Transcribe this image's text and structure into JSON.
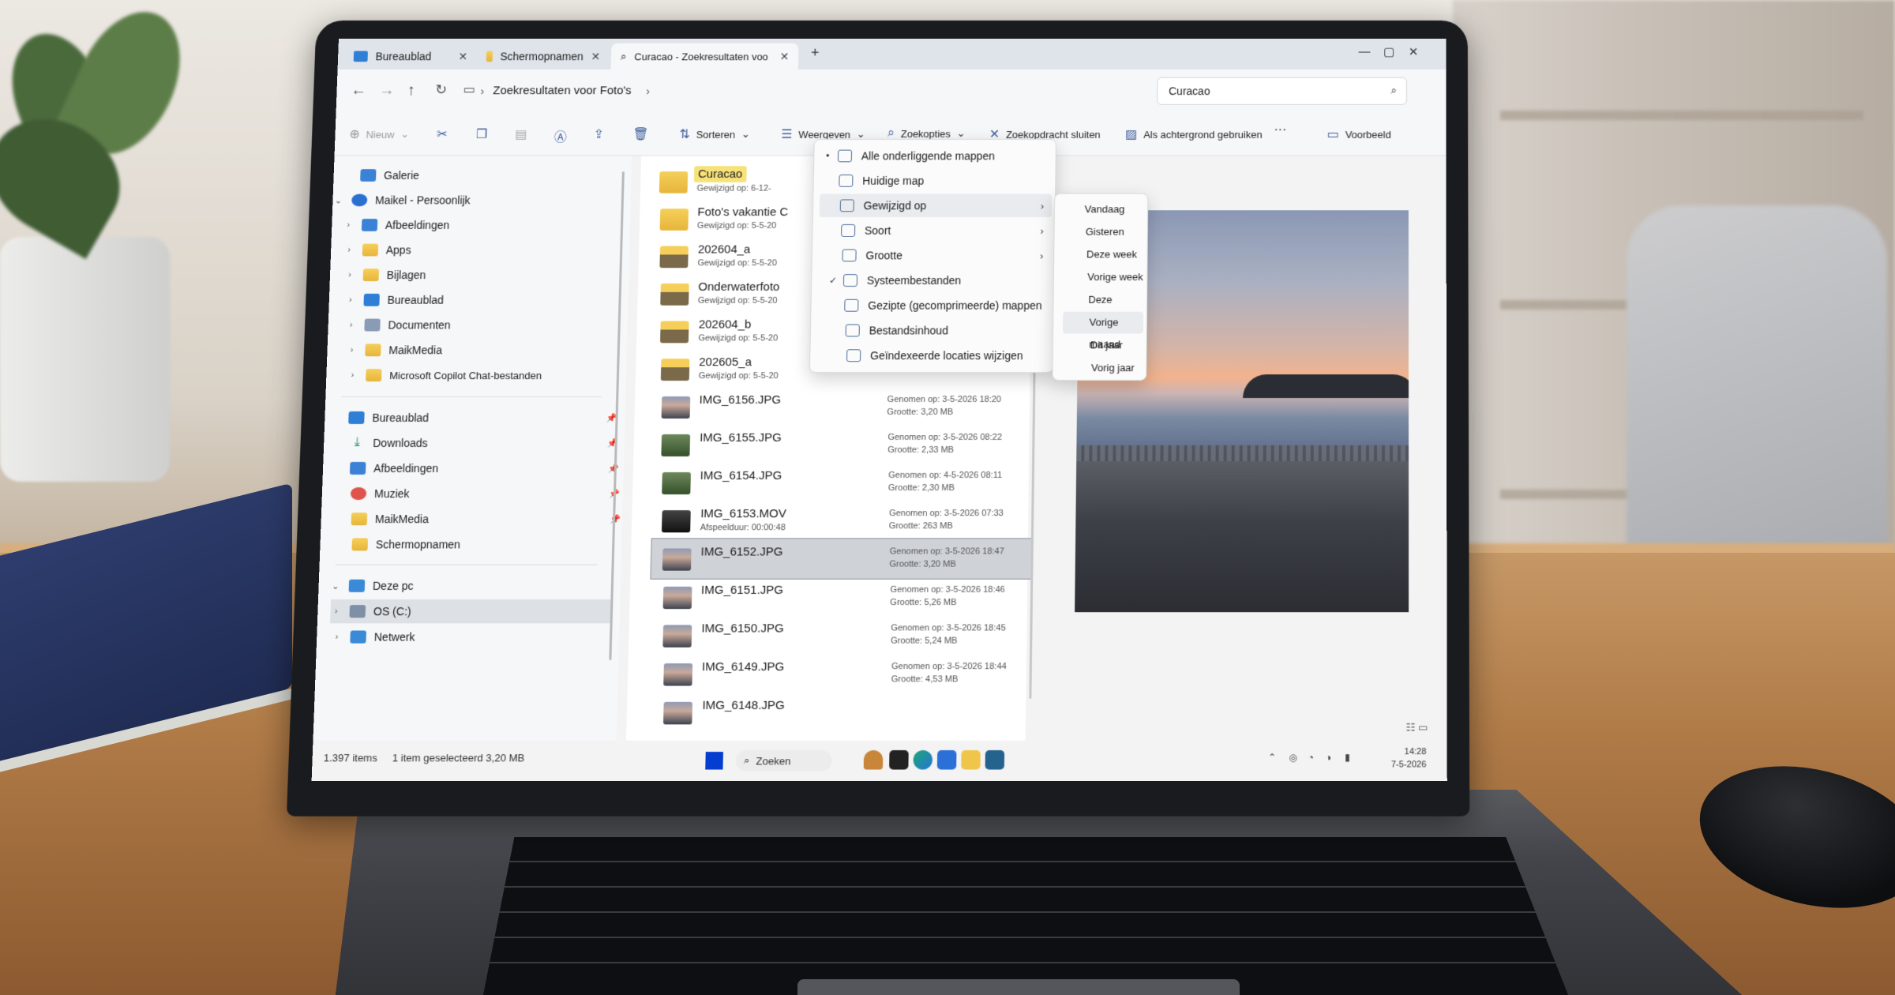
{
  "window": {
    "tabs": [
      {
        "label": "Bureaublad"
      },
      {
        "label": "Schermopnamen"
      },
      {
        "label": "Curacao - Zoekresultaten voo"
      }
    ],
    "new_tab": "+"
  },
  "address": {
    "breadcrumb": "Zoekresultaten voor Foto's",
    "search_value": "Curacao"
  },
  "commands": {
    "new": "Nieuw",
    "sort": "Sorteren",
    "view": "Weergeven",
    "search_options": "Zoekopties",
    "close_search": "Zoekopdracht sluiten",
    "set_background": "Als achtergrond gebruiken",
    "more": "···",
    "preview": "Voorbeeld"
  },
  "nav": {
    "gallery": "Galerie",
    "personal": "Maikel - Persoonlijk",
    "personal_children": [
      "Afbeeldingen",
      "Apps",
      "Bijlagen",
      "Bureaublad",
      "Documenten",
      "MaikMedia",
      "Microsoft Copilot Chat-bestanden"
    ],
    "quick_access": [
      "Bureaublad",
      "Downloads",
      "Afbeeldingen",
      "Muziek",
      "MaikMedia",
      "Schermopnamen"
    ],
    "this_pc": "Deze pc",
    "drive": "OS (C:)",
    "network": "Netwerk"
  },
  "files": [
    {
      "name": "Curacao",
      "sub": "Gewijzigd op: 6-12-",
      "meta1": "",
      "meta2": "",
      "kind": "folder"
    },
    {
      "name": "Foto's vakantie C",
      "sub": "Gewijzigd op: 5-5-20",
      "meta1": "",
      "meta2": "",
      "kind": "folder"
    },
    {
      "name": "202604_a",
      "sub": "Gewijzigd op: 5-5-20",
      "meta1": "",
      "meta2": "",
      "kind": "folder-img"
    },
    {
      "name": "Onderwaterfoto",
      "sub": "Gewijzigd op: 5-5-20",
      "meta1": "",
      "meta2": "",
      "kind": "folder-img"
    },
    {
      "name": "202604_b",
      "sub": "Gewijzigd op: 5-5-20",
      "meta1": "",
      "meta2": "",
      "kind": "folder-img"
    },
    {
      "name": "202605_a",
      "sub": "Gewijzigd op: 5-5-20",
      "meta1": "",
      "meta2": "",
      "kind": "folder-img"
    },
    {
      "name": "IMG_6156.JPG",
      "sub": "",
      "meta1": "Genomen op: 3-5-2026 18:20",
      "meta2": "Grootte: 3,20 MB",
      "kind": "image"
    },
    {
      "name": "IMG_6155.JPG",
      "sub": "",
      "meta1": "Genomen op: 3-5-2026 08:22",
      "meta2": "Grootte: 2,33 MB",
      "kind": "image-green"
    },
    {
      "name": "IMG_6154.JPG",
      "sub": "",
      "meta1": "Genomen op: 4-5-2026 08:11",
      "meta2": "Grootte: 2,30 MB",
      "kind": "image-green"
    },
    {
      "name": "IMG_6153.MOV",
      "sub": "Afspeelduur: 00:00:48",
      "meta1": "Genomen op: 3-5-2026 07:33",
      "meta2": "Grootte: 263 MB",
      "kind": "video"
    },
    {
      "name": "IMG_6152.JPG",
      "sub": "",
      "meta1": "Genomen op: 3-5-2026 18:47",
      "meta2": "Grootte: 3,20 MB",
      "kind": "image"
    },
    {
      "name": "IMG_6151.JPG",
      "sub": "",
      "meta1": "Genomen op: 3-5-2026 18:46",
      "meta2": "Grootte: 5,26 MB",
      "kind": "image"
    },
    {
      "name": "IMG_6150.JPG",
      "sub": "",
      "meta1": "Genomen op: 3-5-2026 18:45",
      "meta2": "Grootte: 5,24 MB",
      "kind": "image"
    },
    {
      "name": "IMG_6149.JPG",
      "sub": "",
      "meta1": "Genomen op: 3-5-2026 18:44",
      "meta2": "Grootte: 4,53 MB",
      "kind": "image"
    },
    {
      "name": "IMG_6148.JPG",
      "sub": "",
      "meta1": "",
      "meta2": "",
      "kind": "image"
    }
  ],
  "menu": {
    "items": [
      "Alle onderliggende mappen",
      "Huidige map",
      "Gewijzigd op",
      "Soort",
      "Grootte",
      "Systeembestanden",
      "Gezipte (gecomprimeerde) mappen",
      "Bestandsinhoud",
      "Geïndexeerde locaties wijzigen"
    ],
    "bullet": "•",
    "check": "✓"
  },
  "submenu": {
    "items": [
      "Vandaag",
      "Gisteren",
      "Deze week",
      "Vorige week",
      "Deze maand",
      "Vorige maand",
      "Dit jaar",
      "Vorig jaar"
    ]
  },
  "status": {
    "count": "1.397 items",
    "selected": "1 item geselecteerd  3,20 MB"
  },
  "taskbar": {
    "search": "Zoeken",
    "time": "14:28",
    "date": "7-5-2026"
  },
  "colors": {
    "accent": "#1e7ee6",
    "folder": "#e7b53a",
    "selection": "#cfd3d8"
  }
}
